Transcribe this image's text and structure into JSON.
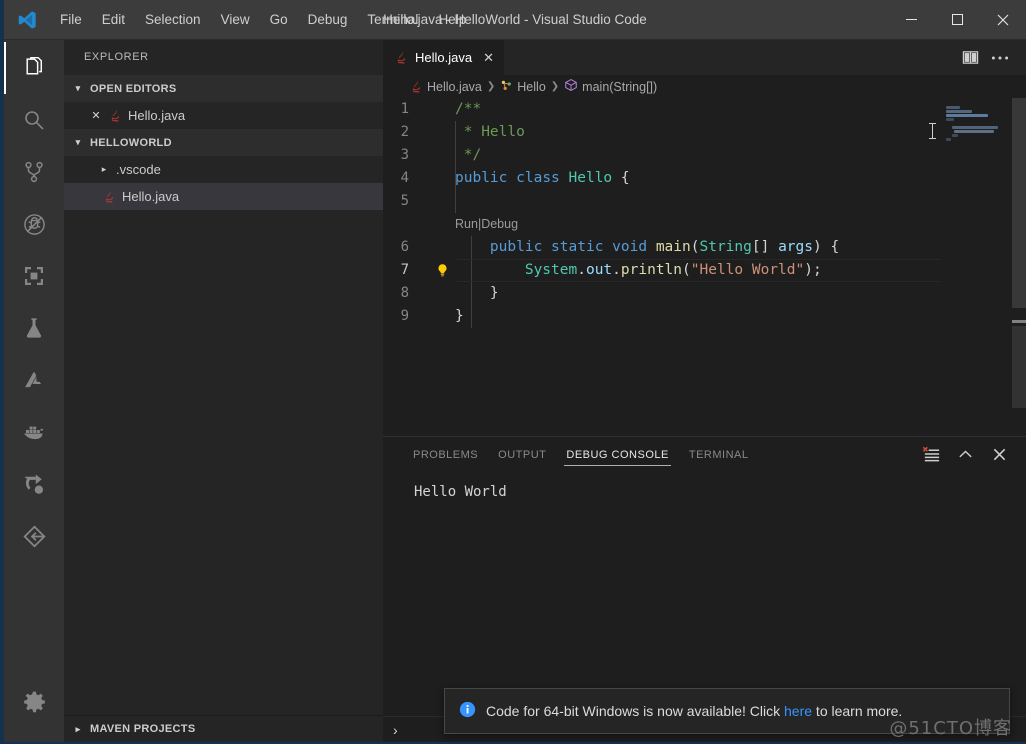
{
  "window": {
    "title": "Hello.java - HelloWorld - Visual Studio Code",
    "logo_icon": "vscode-logo-icon",
    "minimize_icon": "minimize-icon",
    "maximize_icon": "maximize-icon",
    "close_icon": "close-icon"
  },
  "menubar": {
    "items": [
      {
        "label": "File"
      },
      {
        "label": "Edit"
      },
      {
        "label": "Selection"
      },
      {
        "label": "View"
      },
      {
        "label": "Go"
      },
      {
        "label": "Debug"
      },
      {
        "label": "Terminal"
      },
      {
        "label": "Help"
      }
    ]
  },
  "activitybar": {
    "items": [
      {
        "name": "explorer",
        "icon": "files-icon",
        "active": true
      },
      {
        "name": "search",
        "icon": "search-icon",
        "active": false
      },
      {
        "name": "source-control",
        "icon": "source-control-icon",
        "active": false
      },
      {
        "name": "run-and-debug",
        "icon": "debug-icon",
        "active": false
      },
      {
        "name": "extensions",
        "icon": "extensions-icon",
        "active": false
      },
      {
        "name": "test",
        "icon": "flask-icon",
        "active": false
      },
      {
        "name": "azure",
        "icon": "azure-icon",
        "active": false
      },
      {
        "name": "docker",
        "icon": "docker-icon",
        "active": false
      },
      {
        "name": "live-share",
        "icon": "live-share-icon",
        "active": false
      },
      {
        "name": "gitlens",
        "icon": "gitlens-icon",
        "active": false
      }
    ],
    "settings": {
      "name": "manage",
      "icon": "gear-icon"
    }
  },
  "sidebar": {
    "title": "EXPLORER",
    "open_editors": {
      "label": "OPEN EDITORS",
      "expanded": true,
      "items": [
        {
          "label": "Hello.java",
          "icon": "java-file-icon",
          "close_icon": "close-icon"
        }
      ]
    },
    "workspace": {
      "label": "HELLOWORLD",
      "expanded": true,
      "items": [
        {
          "label": ".vscode",
          "type": "folder",
          "expanded": false,
          "selected": false
        },
        {
          "label": "Hello.java",
          "type": "java-file",
          "expanded": false,
          "selected": true
        }
      ]
    },
    "maven": {
      "label": "MAVEN PROJECTS",
      "expanded": false
    }
  },
  "editor": {
    "tab": {
      "label": "Hello.java",
      "icon": "java-file-icon",
      "close_icon": "close-icon",
      "active": true
    },
    "actions": [
      {
        "name": "split-editor",
        "icon": "split-editor-icon"
      },
      {
        "name": "more-actions",
        "icon": "ellipsis-icon"
      }
    ],
    "breadcrumb": [
      {
        "label": "Hello.java",
        "icon": "java-file-icon"
      },
      {
        "label": "Hello",
        "icon": "class-icon"
      },
      {
        "label": "main(String[])",
        "icon": "method-icon"
      }
    ],
    "codelens": {
      "run_label": "Run",
      "separator": "|",
      "debug_label": "Debug"
    },
    "lines": [
      {
        "number": "1",
        "indent": 0,
        "tokens": [
          {
            "t": "/**",
            "c": "tok-cmt"
          }
        ]
      },
      {
        "number": "2",
        "indent": 0,
        "tokens": [
          {
            "t": " * Hello",
            "c": "tok-cmt"
          }
        ]
      },
      {
        "number": "3",
        "indent": 0,
        "tokens": [
          {
            "t": " */",
            "c": "tok-cmt"
          }
        ]
      },
      {
        "number": "4",
        "indent": 0,
        "tokens": [
          {
            "t": "public",
            "c": "tok-kw"
          },
          {
            "t": " ",
            "c": "tok-plain"
          },
          {
            "t": "class",
            "c": "tok-kw"
          },
          {
            "t": " ",
            "c": "tok-plain"
          },
          {
            "t": "Hello",
            "c": "tok-type"
          },
          {
            "t": " {",
            "c": "tok-plain"
          }
        ]
      },
      {
        "number": "5",
        "indent": 0,
        "tokens": []
      },
      {
        "number": "6",
        "indent": 0,
        "tokens": [
          {
            "t": "    ",
            "c": "tok-plain"
          },
          {
            "t": "public",
            "c": "tok-kw"
          },
          {
            "t": " ",
            "c": "tok-plain"
          },
          {
            "t": "static",
            "c": "tok-kw"
          },
          {
            "t": " ",
            "c": "tok-plain"
          },
          {
            "t": "void",
            "c": "tok-kw"
          },
          {
            "t": " ",
            "c": "tok-plain"
          },
          {
            "t": "main",
            "c": "tok-fn"
          },
          {
            "t": "(",
            "c": "tok-plain"
          },
          {
            "t": "String",
            "c": "tok-type"
          },
          {
            "t": "[] ",
            "c": "tok-plain"
          },
          {
            "t": "args",
            "c": "tok-var"
          },
          {
            "t": ") {",
            "c": "tok-plain"
          }
        ]
      },
      {
        "number": "7",
        "indent": 0,
        "lightbulb": true,
        "current": true,
        "tokens": [
          {
            "t": "        ",
            "c": "tok-plain"
          },
          {
            "t": "System",
            "c": "tok-type"
          },
          {
            "t": ".",
            "c": "tok-plain"
          },
          {
            "t": "out",
            "c": "tok-var"
          },
          {
            "t": ".",
            "c": "tok-plain"
          },
          {
            "t": "println",
            "c": "tok-fn"
          },
          {
            "t": "(",
            "c": "tok-plain"
          },
          {
            "t": "\"Hello World\"",
            "c": "tok-str"
          },
          {
            "t": ");",
            "c": "tok-plain"
          }
        ]
      },
      {
        "number": "8",
        "indent": 0,
        "tokens": [
          {
            "t": "    }",
            "c": "tok-plain"
          }
        ]
      },
      {
        "number": "9",
        "indent": 0,
        "tokens": [
          {
            "t": "}",
            "c": "tok-plain"
          }
        ]
      }
    ]
  },
  "panel": {
    "tabs": [
      {
        "label": "PROBLEMS",
        "active": false
      },
      {
        "label": "OUTPUT",
        "active": false
      },
      {
        "label": "DEBUG CONSOLE",
        "active": true
      },
      {
        "label": "TERMINAL",
        "active": false
      }
    ],
    "actions": [
      {
        "name": "clear-console",
        "icon": "clear-console-icon"
      },
      {
        "name": "maximize-panel",
        "icon": "chevron-up-icon"
      },
      {
        "name": "close-panel",
        "icon": "close-icon"
      }
    ],
    "output": "Hello World"
  },
  "statusbar": {
    "chevron": "›"
  },
  "notification": {
    "icon": "info-icon",
    "text_before": "Code for 64-bit Windows is now available! Click ",
    "link": "here",
    "text_after": " to learn more."
  },
  "watermark": "@51CTO博客",
  "colors": {
    "titlebar_bg": "#3c3c3c",
    "activitybar_bg": "#333333",
    "sidebar_bg": "#252526",
    "editor_bg": "#1e1e1e",
    "accent_link": "#3794ff",
    "selection_bg": "#37373d",
    "window_border": "#16314d",
    "comment": "#6a9955",
    "keyword": "#569cd6",
    "type": "#4ec9b0",
    "function": "#dcdcaa",
    "string": "#ce9178",
    "variable": "#9cdcfe"
  }
}
